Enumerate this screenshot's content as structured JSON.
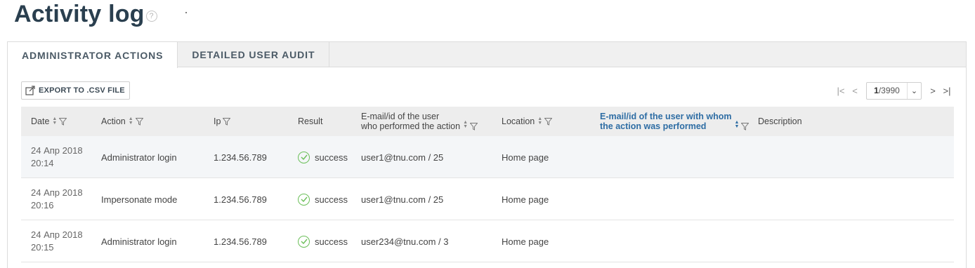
{
  "page": {
    "title": "Activity log",
    "help_symbol": "?"
  },
  "tabs": [
    {
      "label": "ADMINISTRATOR ACTIONS",
      "active": true
    },
    {
      "label": "DETAILED USER AUDIT",
      "active": false
    }
  ],
  "toolbar": {
    "export_label": "EXPORT TO .CSV FILE"
  },
  "pager": {
    "current": "1",
    "total": "/3990"
  },
  "table": {
    "headers": {
      "date": "Date",
      "action": "Action",
      "ip": "Ip",
      "result": "Result",
      "performer_line1": "E-mail/id of the user",
      "performer_line2": "who performed the action",
      "location": "Location",
      "target_line1": "E-mail/id of the user with whom",
      "target_line2": "the action was performed",
      "description": "Description"
    },
    "rows": [
      {
        "date": "24 Апр 2018",
        "time": "20:14",
        "action": "Administrator login",
        "ip": "1.234.56.789",
        "result": "success",
        "performer": "user1@tnu.com / 25",
        "location": "Home page",
        "target": "",
        "description": ""
      },
      {
        "date": "24 Апр 2018",
        "time": "20:16",
        "action": "Impersonate mode",
        "ip": "1.234.56.789",
        "result": "success",
        "performer": "user1@tnu.com / 25",
        "location": "Home page",
        "target": "",
        "description": ""
      },
      {
        "date": "24 Апр 2018",
        "time": "20:15",
        "action": "Administrator login",
        "ip": "1.234.56.789",
        "result": "success",
        "performer": "user234@tnu.com / 3",
        "location": "Home page",
        "target": "",
        "description": ""
      }
    ]
  },
  "colors": {
    "title": "#2a3f4f",
    "accent_blue": "#2e6da4",
    "success_green": "#6bbf59",
    "header_bg": "#ededed",
    "highlight_row": "#f4f6f8"
  }
}
